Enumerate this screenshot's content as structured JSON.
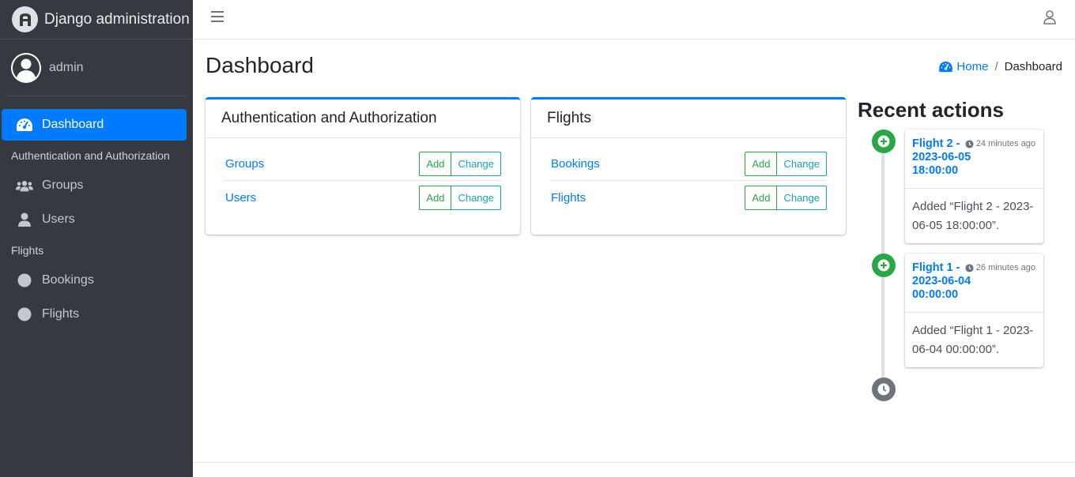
{
  "brand": {
    "title": "Django administration"
  },
  "user": {
    "name": "admin"
  },
  "sidebar": {
    "dashboard_label": "Dashboard",
    "sections": [
      {
        "header": "Authentication and Authorization",
        "items": [
          "Groups",
          "Users"
        ]
      },
      {
        "header": "Flights",
        "items": [
          "Bookings",
          "Flights"
        ]
      }
    ]
  },
  "page": {
    "title": "Dashboard"
  },
  "breadcrumb": {
    "home": "Home",
    "separator": "/",
    "current": "Dashboard"
  },
  "apps": [
    {
      "name": "Authentication and Authorization",
      "models": [
        {
          "name": "Groups",
          "add": "Add",
          "change": "Change"
        },
        {
          "name": "Users",
          "add": "Add",
          "change": "Change"
        }
      ]
    },
    {
      "name": "Flights",
      "models": [
        {
          "name": "Bookings",
          "add": "Add",
          "change": "Change"
        },
        {
          "name": "Flights",
          "add": "Add",
          "change": "Change"
        }
      ]
    }
  ],
  "recent": {
    "title": "Recent actions",
    "items": [
      {
        "link": "Flight 2 - 2023-06-05 18:00:00",
        "time": "24 minutes ago",
        "message": "Added “Flight 2 - 2023-06-05 18:00:00”."
      },
      {
        "link": "Flight 1 - 2023-06-04 00:00:00",
        "time": "26 minutes ago",
        "message": "Added “Flight 1 - 2023-06-04 00:00:00”."
      }
    ]
  },
  "colors": {
    "sidebar": "#343a40",
    "primary": "#007bff",
    "success": "#28a745",
    "info": "#17a2b8"
  }
}
